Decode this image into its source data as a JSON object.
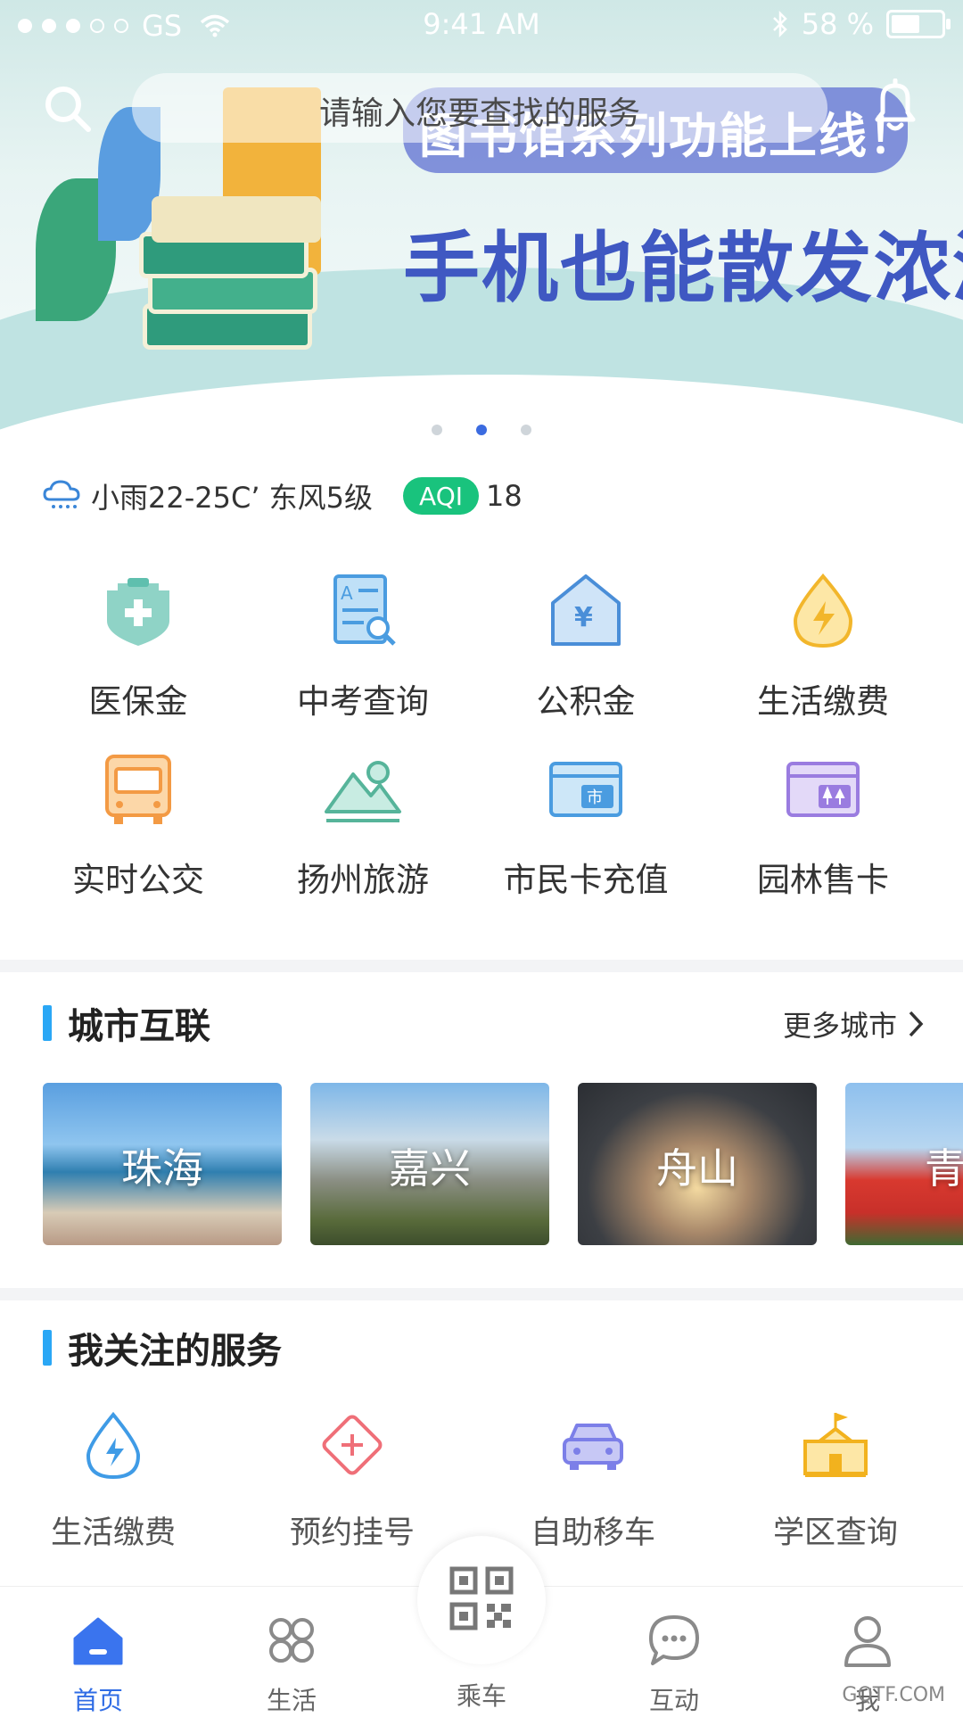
{
  "status_bar": {
    "carrier": "GS",
    "time": "9:41 AM",
    "battery_text": "58 %",
    "battery_level": 0.58,
    "signal_bars_filled": 3,
    "signal_bars_total": 5
  },
  "search": {
    "placeholder": "请输入您要查找的服务"
  },
  "banner": {
    "pill_text": "图书馆系列功能上线！",
    "headline": "手机也能散发浓浓书香",
    "slide_count": 3,
    "active_slide": 2
  },
  "weather": {
    "text": "小雨22-25C’ 东风5级",
    "aqi_label": "AQI",
    "aqi_value": "18"
  },
  "services": [
    {
      "label": "医保金",
      "icon": "medical-insurance-icon"
    },
    {
      "label": "中考查询",
      "icon": "exam-query-icon"
    },
    {
      "label": "公积金",
      "icon": "housing-fund-icon"
    },
    {
      "label": "生活缴费",
      "icon": "utility-payment-icon"
    },
    {
      "label": "实时公交",
      "icon": "bus-icon"
    },
    {
      "label": "扬州旅游",
      "icon": "travel-mountain-icon"
    },
    {
      "label": "市民卡充值",
      "icon": "citizen-card-icon"
    },
    {
      "label": "园林售卡",
      "icon": "garden-card-icon"
    }
  ],
  "city_section": {
    "title": "城市互联",
    "more": "更多城市",
    "cities": [
      "珠海",
      "嘉兴",
      "舟山",
      "青"
    ]
  },
  "followed_section": {
    "title": "我关注的服务",
    "items": [
      {
        "label": "生活缴费",
        "icon": "water-drop-icon"
      },
      {
        "label": "预约挂号",
        "icon": "medical-cross-icon"
      },
      {
        "label": "自助移车",
        "icon": "car-icon"
      },
      {
        "label": "学区查询",
        "icon": "school-icon"
      }
    ]
  },
  "tabbar": {
    "tabs": [
      {
        "label": "首页",
        "icon": "home-icon"
      },
      {
        "label": "生活",
        "icon": "life-grid-icon"
      },
      {
        "label": "乘车",
        "icon": "qr-code-icon"
      },
      {
        "label": "互动",
        "icon": "chat-icon"
      },
      {
        "label": "我",
        "icon": "user-icon"
      }
    ]
  },
  "colors": {
    "accent_blue": "#2f6ce5",
    "section_bar": "#2aa7f5",
    "aqi_green": "#19c37d"
  },
  "watermark": "GQTF.COM"
}
